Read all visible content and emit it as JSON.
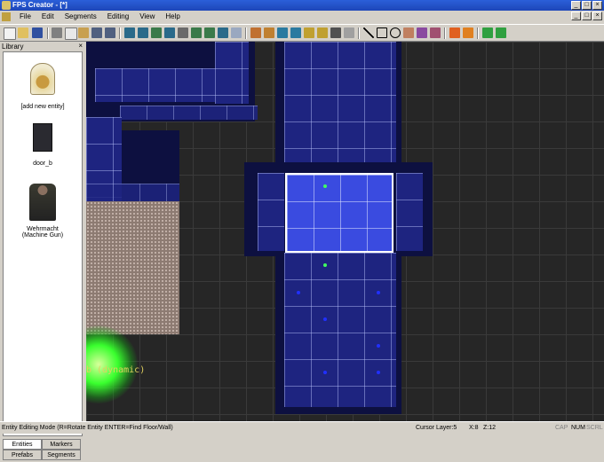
{
  "window": {
    "title": "FPS Creator - [*]",
    "buttons": [
      "_",
      "□",
      "×"
    ]
  },
  "menu": {
    "items": [
      "File",
      "Edit",
      "Segments",
      "Editing",
      "View",
      "Help"
    ]
  },
  "library": {
    "title": "Library",
    "close": "×",
    "entities": [
      {
        "label": "[add new entity]",
        "icon": "entity-bell-jar-icon"
      },
      {
        "label": "door_b",
        "icon": "door-icon"
      },
      {
        "label": "Wehrmacht (Machine Gun)",
        "icon": "soldier-icon"
      }
    ],
    "tabs": [
      "Entities",
      "Markers",
      "Prefabs",
      "Segments"
    ]
  },
  "viewport": {
    "dynamic_label": "b (dynamic)"
  },
  "status": {
    "mode": "Entity Editing Mode (R=Rotate Entity  ENTER=Find Floor/Wall)",
    "cursor_layer": "Cursor Layer:5",
    "x": "X:8",
    "z": "Z:12",
    "cap": "CAP",
    "num": "NUM",
    "scrl": "SCRL"
  },
  "colors": {
    "titlebar": "#1d46b8",
    "wall": "#1e2480",
    "grid": "#262626",
    "selection": "#ffffff",
    "glow": "#39ff2e"
  }
}
